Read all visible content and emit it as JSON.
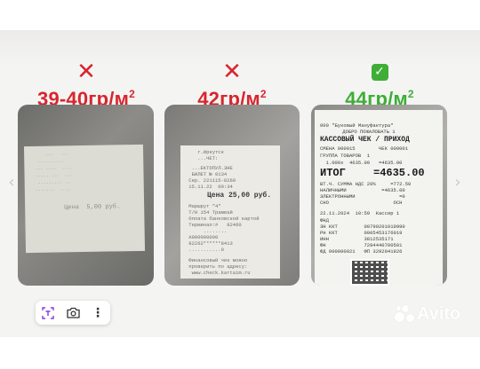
{
  "columns": [
    {
      "status": "bad",
      "mark": "✕",
      "label_main": "39-40гр/м",
      "label_sup": "2"
    },
    {
      "status": "bad",
      "mark": "✕",
      "label_main": "42гр/м",
      "label_sup": "2"
    },
    {
      "status": "good",
      "mark": "✓",
      "label_main": "44гр/м",
      "label_sup": "2"
    }
  ],
  "receipt1": {
    "lines": [
      "      ...   ...   ",
      "   ..........    ",
      "  ... ....  ....  ",
      "  ..... ...  ...  ",
      "   ......... ..   ",
      "  .......  ....   "
    ],
    "price": "Цена  5,00 руб."
  },
  "receipt2": {
    "lines": [
      "    г.Иркутск",
      "    ...ЧЕТ:",
      "  ...ЕКТОПУЛ.ЗНЕ",
      "  БИЛЕТ № 0134",
      " Сер. 221115-8260",
      " 15.11.22  09:34"
    ],
    "price": "Цена 25,00 руб.",
    "lines2": [
      " Маршрут \"4\"",
      " Т/Н 154 Трамвай",
      " Оплата банковской картой",
      " Терминал:#   82460",
      "      ........   ",
      " А000000000",
      " 82262******8413",
      " ...........0",
      "",
      " Финансовый чек можно",
      " проверить по адресу:",
      "  www.check.kartaim.ru"
    ]
  },
  "receipt3": {
    "header": [
      "000 \"Буковый Мануфактура\"",
      "    ДОБРО ПОЖАЛОВАТЬ 1"
    ],
    "title": "КАССОВЫЙ ЧЕК / ПРИХОД",
    "rows": [
      "СМЕНА 000015        ЧЕК 000001",
      "ГРУППА ТОВАРОВ  1",
      "  1.000x  4635.00   =4635.00"
    ],
    "total_label": "ИТОГ",
    "total_value": "=4635.00",
    "rows2": [
      "ВТ.Ч. СУММА НДС 20%     =772.50",
      "НАЛИЧНЫМИ            =4635.00",
      "ЭЛЕКТРОННЫМИ               =0",
      "СНО                      ОСН",
      "",
      "22.11.2024  10:59  Кассир 1",
      "ФНД",
      "ЗН ККТ         00799201010990",
      "РН ККТ         0005453176019",
      "ИНН            3812535171",
      "ФН             7284440700501",
      "ФД 000000021   ФП 3292041926"
    ]
  },
  "toolbar": {
    "icons": [
      "scan-text-icon",
      "camera-icon",
      "more-icon"
    ],
    "more": "⋮"
  },
  "watermark": {
    "text": "Avito"
  },
  "nav": {
    "left": "‹",
    "right": "›"
  },
  "colors": {
    "bad": "#d7262e",
    "good": "#3fae37",
    "stage": "#f4f4f3"
  }
}
